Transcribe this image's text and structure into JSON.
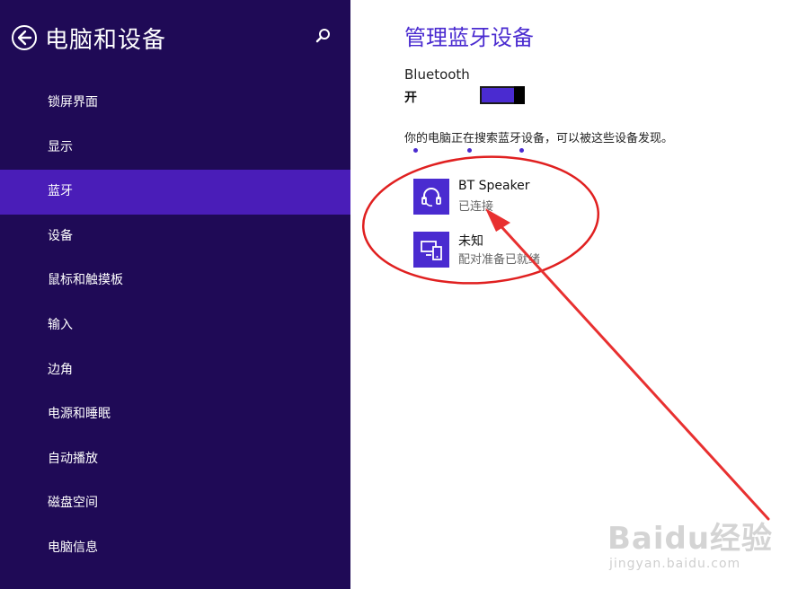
{
  "sidebar": {
    "title": "电脑和设备",
    "items": [
      {
        "label": "锁屏界面"
      },
      {
        "label": "显示"
      },
      {
        "label": "蓝牙",
        "active": true
      },
      {
        "label": "设备"
      },
      {
        "label": "鼠标和触摸板"
      },
      {
        "label": "输入"
      },
      {
        "label": "边角"
      },
      {
        "label": "电源和睡眠"
      },
      {
        "label": "自动播放"
      },
      {
        "label": "磁盘空间"
      },
      {
        "label": "电脑信息"
      }
    ]
  },
  "main": {
    "title": "管理蓝牙设备",
    "bluetooth_label": "Bluetooth",
    "bluetooth_state": "开",
    "bluetooth_on": true,
    "search_note": "你的电脑正在搜索蓝牙设备，可以被这些设备发现。",
    "devices": [
      {
        "name": "BT Speaker",
        "status": "已连接",
        "icon": "headset-icon"
      },
      {
        "name": "未知",
        "status": "配对准备已就绪",
        "icon": "devices-icon"
      }
    ]
  },
  "watermark": {
    "logo": "Baidu经验",
    "url": "jingyan.baidu.com"
  },
  "colors": {
    "sidebar_bg": "#1f0a56",
    "active_item": "#4a1db8",
    "accent": "#4a2bd0",
    "annotation_red": "#e02020"
  }
}
